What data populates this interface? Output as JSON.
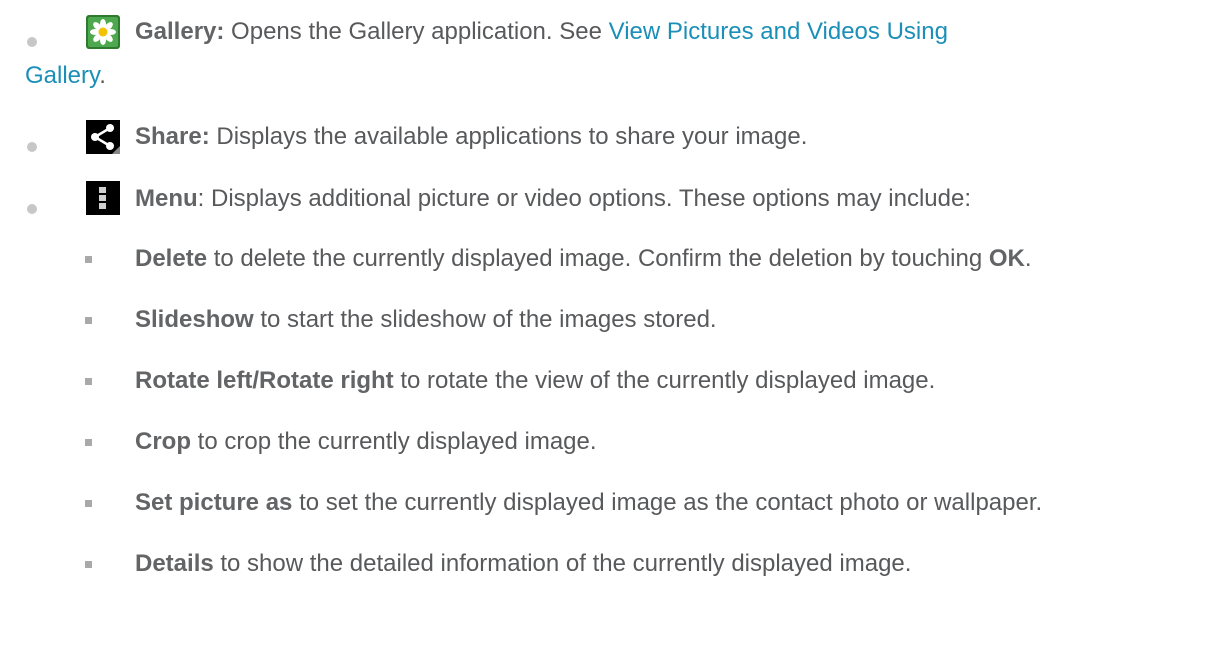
{
  "items": [
    {
      "icon": "gallery-icon",
      "label": "Gallery:",
      "text": " Opens the Gallery application. See ",
      "link_part1": "View Pictures and Videos Using",
      "link_part2": "Gallery",
      "end": "."
    },
    {
      "icon": "share-icon",
      "label": "Share:",
      "text": " Displays the available applications to share your image."
    },
    {
      "icon": "menu-icon",
      "label": "Menu",
      "text": ": Displays additional picture or video options. These options may include:"
    }
  ],
  "sub_items": [
    {
      "label": "Delete",
      "text": " to delete the currently displayed image. Confirm the deletion by touching ",
      "label2": "OK",
      "end": "."
    },
    {
      "label": "Slideshow",
      "text": " to start the slideshow of the images stored."
    },
    {
      "label": "Rotate left/Rotate right",
      "text": " to rotate the view of the currently displayed image."
    },
    {
      "label": "Crop",
      "text": " to crop the currently displayed image."
    },
    {
      "label": "Set picture as",
      "text": " to set the currently displayed image as the contact photo or wallpaper."
    },
    {
      "label": "Details",
      "text": " to show the detailed information of the currently displayed image."
    }
  ],
  "colors": {
    "text": "#58595b",
    "link": "#1b8fb8",
    "bullet": "#c7c7c7",
    "square_bullet": "#a9a9a9"
  }
}
